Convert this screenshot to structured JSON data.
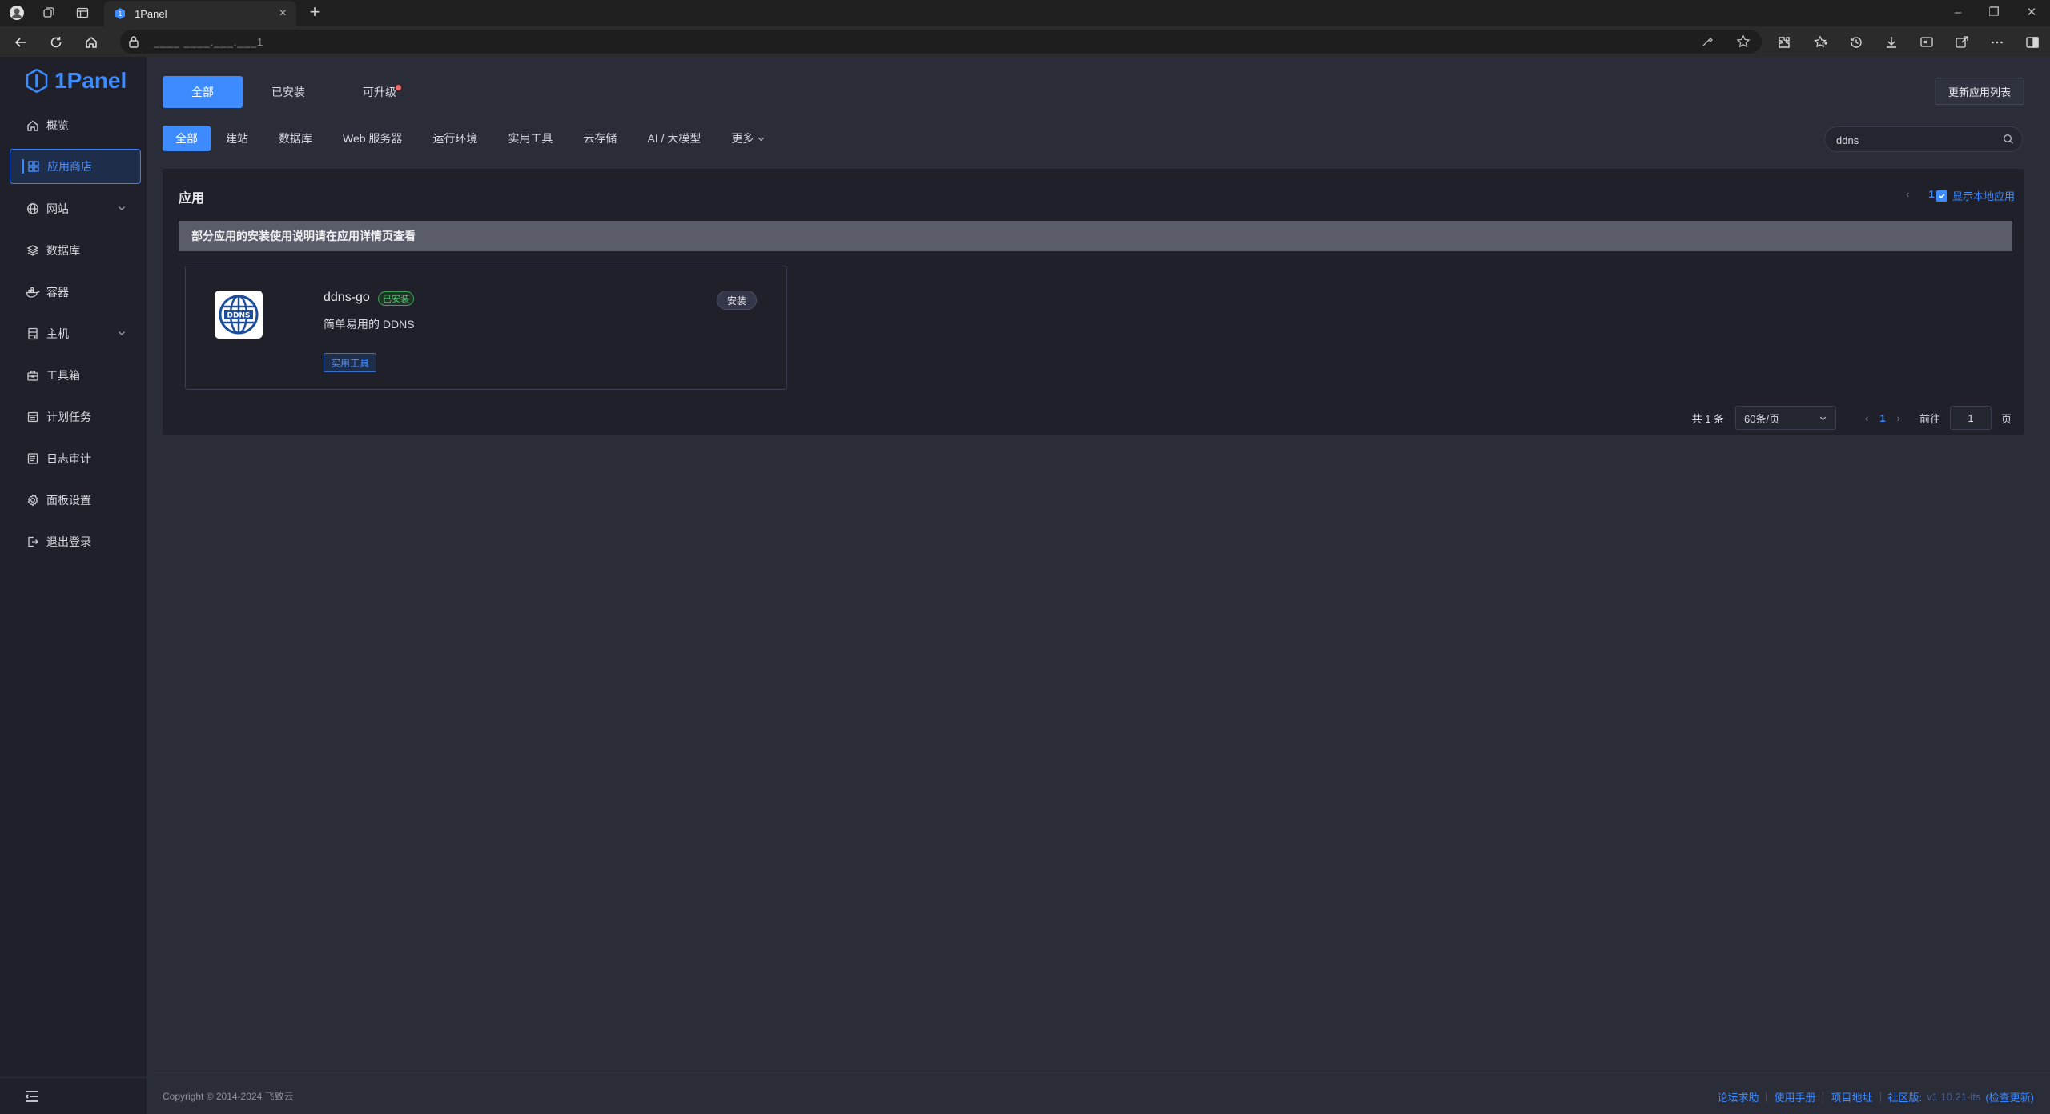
{
  "browser": {
    "tab_title": "1Panel",
    "url": "____ ____.___.___1"
  },
  "sidebar": {
    "logo": "1Panel",
    "items": [
      {
        "label": "概览",
        "icon": "home-icon"
      },
      {
        "label": "应用商店",
        "icon": "grid-icon"
      },
      {
        "label": "网站",
        "icon": "globe-icon"
      },
      {
        "label": "数据库",
        "icon": "layers-icon"
      },
      {
        "label": "容器",
        "icon": "docker-icon"
      },
      {
        "label": "主机",
        "icon": "server-icon"
      },
      {
        "label": "工具箱",
        "icon": "toolbox-icon"
      },
      {
        "label": "计划任务",
        "icon": "calendar-icon"
      },
      {
        "label": "日志审计",
        "icon": "log-icon"
      },
      {
        "label": "面板设置",
        "icon": "gear-icon"
      },
      {
        "label": "退出登录",
        "icon": "logout-icon"
      }
    ]
  },
  "top_tabs": [
    "全部",
    "已安装",
    "可升级"
  ],
  "refresh_button": "更新应用列表",
  "categories": [
    "全部",
    "建站",
    "数据库",
    "Web 服务器",
    "运行环境",
    "实用工具",
    "云存储",
    "AI / 大模型",
    "更多"
  ],
  "search": {
    "value": "ddns"
  },
  "panel": {
    "title": "应用",
    "page": "1",
    "show_local": "显示本地应用",
    "notice": "部分应用的安装使用说明请在应用详情页查看"
  },
  "app_card": {
    "logo_text": "DDNS",
    "name": "ddns-go",
    "installed_tag": "已安装",
    "description": "简单易用的 DDNS",
    "category_tag": "实用工具",
    "install_button": "安装"
  },
  "pagination": {
    "total": "共 1 条",
    "page_size": "60条/页",
    "current": "1",
    "goto_label": "前往",
    "goto_value": "1",
    "page_suffix": "页"
  },
  "footer": {
    "copyright": "Copyright © 2014-2024 飞致云",
    "links": [
      "论坛求助",
      "使用手册",
      "项目地址"
    ],
    "edition": "社区版:",
    "version": "v1.10.21-lts",
    "check_update": "(检查更新)"
  },
  "colors": {
    "accent": "#3d8bff",
    "installed": "#4fc06b",
    "badge": "#f56c6c"
  }
}
